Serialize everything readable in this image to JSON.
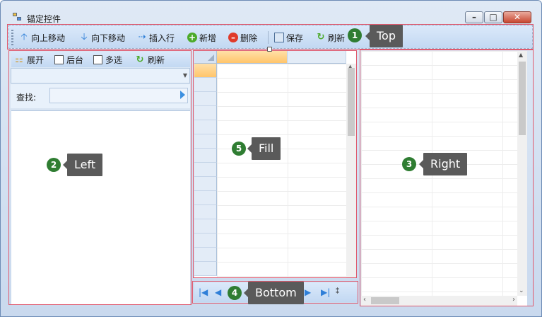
{
  "window": {
    "title": "锚定控件"
  },
  "top_toolbar": {
    "items": [
      {
        "label": "向上移动",
        "icon": "arrow-up-icon"
      },
      {
        "label": "向下移动",
        "icon": "arrow-down-icon"
      },
      {
        "label": "插入行",
        "icon": "insert-row-icon"
      },
      {
        "label": "新增",
        "icon": "add-icon"
      },
      {
        "label": "删除",
        "icon": "delete-icon"
      },
      {
        "label": "保存",
        "icon": "save-icon"
      },
      {
        "label": "刷新",
        "icon": "refresh-icon"
      }
    ]
  },
  "left_panel": {
    "toolbar": {
      "expand_label": "展开",
      "background_label": "后台",
      "multiselect_label": "多选",
      "refresh_label": "刷新"
    },
    "search_label": "查找:",
    "search_value": ""
  },
  "callouts": {
    "top": {
      "number": "1",
      "label": "Top"
    },
    "left": {
      "number": "2",
      "label": "Left"
    },
    "right": {
      "number": "3",
      "label": "Right"
    },
    "bottom": {
      "number": "4",
      "label": "Bottom"
    },
    "fill": {
      "number": "5",
      "label": "Fill"
    }
  },
  "colors": {
    "region_outline": "#e05a6e",
    "toolbar_bg": "#c2d8f2",
    "callout_bg": "#5a5a5a",
    "badge_bg": "#2f7d32",
    "selected_header": "#ffc56b"
  }
}
